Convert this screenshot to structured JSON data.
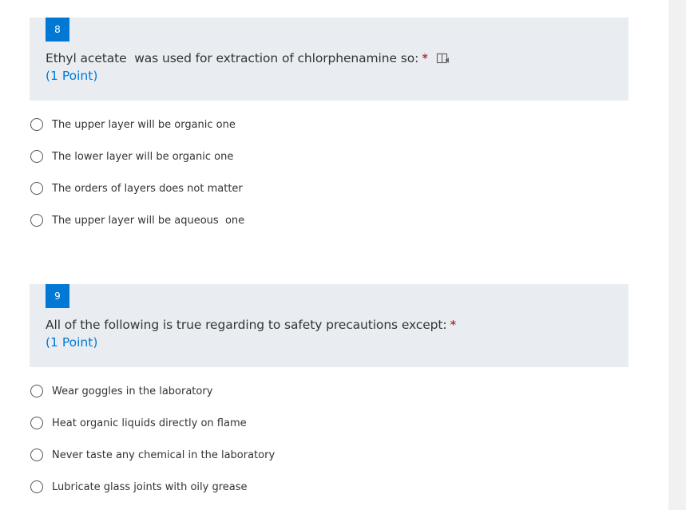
{
  "questions": [
    {
      "number": "8",
      "title": "Ethyl acetate  was used for extraction of chlorphenamine so:",
      "required_mark": "*",
      "points": "(1 Point)",
      "has_reader_icon": true,
      "options": [
        "The upper layer will be organic one",
        "The lower layer will be organic one",
        "The orders of layers does not matter",
        "The upper layer will be aqueous  one"
      ]
    },
    {
      "number": "9",
      "title": "All of the following is true regarding to safety precautions except:",
      "required_mark": "*",
      "points": "(1 Point)",
      "has_reader_icon": false,
      "options": [
        "Wear goggles in the laboratory",
        "Heat organic liquids directly on flame",
        "Never taste any chemical in the laboratory",
        "Lubricate glass joints with oily grease"
      ]
    }
  ],
  "colors": {
    "accent": "#0078d4",
    "required": "#a80000",
    "question_bg": "#e9edf2"
  }
}
